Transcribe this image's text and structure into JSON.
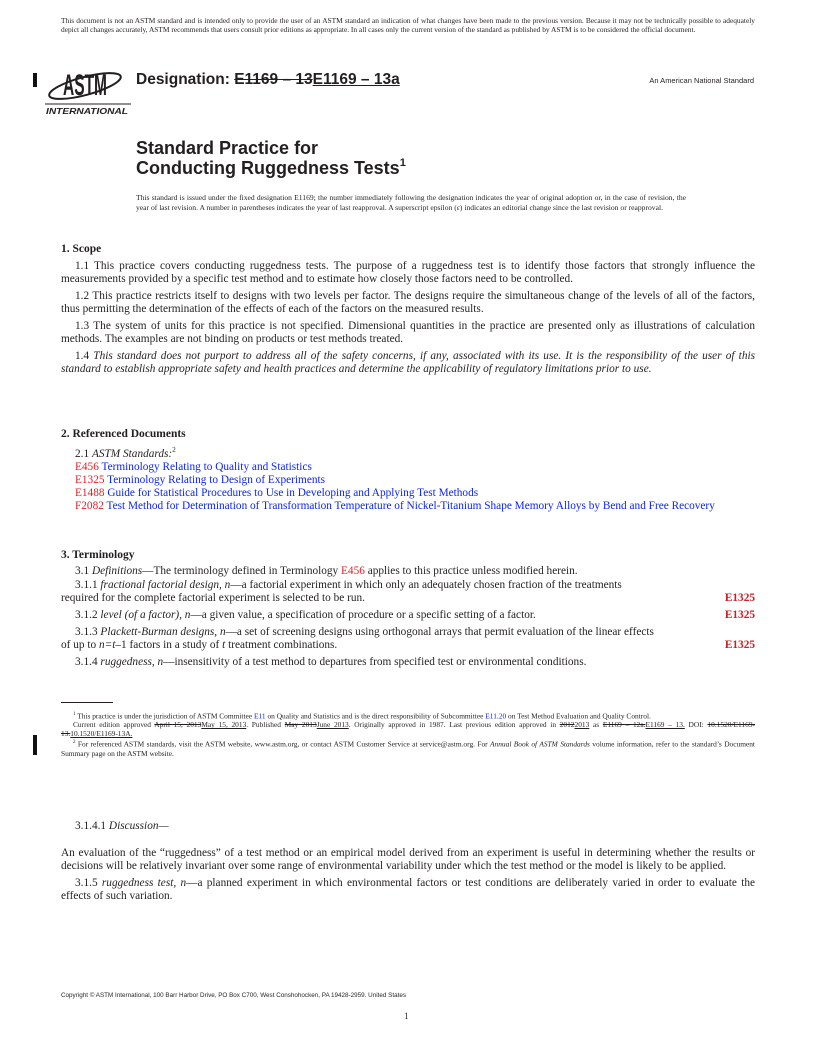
{
  "notice": "This document is not an ASTM standard and is intended only to provide the user of an ASTM standard an indication of what changes have been made to the previous version. Because it may not be technically possible to adequately depict all changes accurately, ASTM recommends that users consult prior editions as appropriate. In all cases only the current version of the standard as published by ASTM is to be considered the official document.",
  "header": {
    "logo_text": "ASTM",
    "logo_subtext": "INTERNATIONAL",
    "designation_label": "Designation:",
    "designation_old": "E1169 – 13",
    "designation_new": "E1169 – 13a",
    "national_standard": "An American National Standard"
  },
  "title": {
    "line1": "Standard Practice for",
    "line2": "Conducting Ruggedness Tests",
    "footnote_mark": "1"
  },
  "issued_note": "This standard is issued under the fixed designation E1169; the number immediately following the designation indicates the year of original adoption or, in the case of revision, the year of last revision. A number in parentheses indicates the year of last reapproval. A superscript epsilon (ε) indicates an editorial change since the last revision or reapproval.",
  "scope": {
    "heading": "1. Scope",
    "p1_1": "1.1 This practice covers conducting ruggedness tests. The purpose of a ruggedness test is to identify those factors that strongly influence the measurements provided by a specific test method and to estimate how closely those factors need to be controlled.",
    "p1_2": "1.2 This practice restricts itself to designs with two levels per factor. The designs require the simultaneous change of the levels of all of the factors, thus permitting the determination of the effects of each of the factors on the measured results.",
    "p1_3": "1.3 The system of units for this practice is not specified. Dimensional quantities in the practice are presented only as illustrations of calculation methods. The examples are not binding on products or test methods treated.",
    "p1_4_num": "1.4",
    "p1_4": "This standard does not purport to address all of the safety concerns, if any, associated with its use. It is the responsibility of the user of this standard to establish appropriate safety and health practices and determine the applicability of regulatory limitations prior to use."
  },
  "referenced": {
    "heading": "2. Referenced Documents",
    "intro_num": "2.1",
    "intro": "ASTM Standards:",
    "intro_mark": "2",
    "items": [
      {
        "code": "E456",
        "title": "Terminology Relating to Quality and Statistics"
      },
      {
        "code": "E1325",
        "title": "Terminology Relating to Design of Experiments"
      },
      {
        "code": "E1488",
        "title": "Guide for Statistical Procedures to Use in Developing and Applying Test Methods"
      },
      {
        "code": "F2082",
        "title": "Test Method for Determination of Transformation Temperature of Nickel-Titanium Shape Memory Alloys by Bend and Free Recovery"
      }
    ]
  },
  "terminology": {
    "heading": "3. Terminology",
    "t3_1_num": "3.1",
    "t3_1_term": "Definitions",
    "t3_1_a": "—The terminology defined in Terminology",
    "t3_1_ref": "E456",
    "t3_1_b": "applies to this practice unless modified herein.",
    "t3_1_1_num": "3.1.1",
    "t3_1_1_term": "fractional factorial design, n",
    "t3_1_1_a": "—a factorial experiment in which only an adequately chosen fraction of the treatments",
    "t3_1_1_b": "required for the complete factorial experiment is selected to be run.",
    "t3_1_1_src": "E1325",
    "t3_1_2_num": "3.1.2",
    "t3_1_2_term": "level (of a factor), n",
    "t3_1_2_a": "—a given value, a specification of procedure or a specific setting of a factor.",
    "t3_1_2_src": "E1325",
    "t3_1_3_num": "3.1.3",
    "t3_1_3_term": "Plackett-Burman designs, n",
    "t3_1_3_a": "—a set of screening designs using orthogonal arrays that permit evaluation of the linear effects",
    "t3_1_3_b1": "of up to",
    "t3_1_3_n": "n=t",
    "t3_1_3_b2": "–1 factors in a study of",
    "t3_1_3_t": "t",
    "t3_1_3_b3": "treatment combinations.",
    "t3_1_3_src": "E1325",
    "t3_1_4_num": "3.1.4",
    "t3_1_4_term": "ruggedness, n",
    "t3_1_4_a": "—insensitivity of a test method to departures from specified test or environmental conditions.",
    "t3_1_4_1_num": "3.1.4.1",
    "t3_1_4_1_term": "Discussion—",
    "discussion": "An evaluation of the “ruggedness” of a test method or an empirical model derived from an experiment is useful in determining whether the results or decisions will be relatively invariant over some range of environmental variability under which the test method or the model is likely to be applied.",
    "t3_1_5_num": "3.1.5",
    "t3_1_5_term": "ruggedness test, n",
    "t3_1_5_a": "—a planned experiment in which environmental factors or test conditions are deliberately varied in order to evaluate the effects of such variation."
  },
  "footnotes": {
    "fn1_mark": "1",
    "fn1_a": "This practice is under the jurisdiction of ASTM Committee",
    "fn1_ref1": "E11",
    "fn1_b": "on Quality and Statistics and is the direct responsibility of Subcommittee",
    "fn1_ref2": "E11.20",
    "fn1_c": "on Test Method Evaluation and Quality Control.",
    "edition_a": "Current edition approved",
    "edition_old_date": "April 15, 2013",
    "edition_new_date": "May 15, 2013",
    "edition_b": ". Published",
    "published_old": "May 2013",
    "published_new": "June 2013",
    "edition_c": ". Originally approved in 1987. Last previous edition approved in",
    "prev_old": "2012",
    "prev_new": "2013",
    "edition_d": "as",
    "as_old": "E1169 – 12a.",
    "as_new": "E1169 – 13.",
    "doi_label": "DOI:",
    "doi_old": "10.1520/E1169-13.",
    "doi_new": "10.1520/E1169-13A.",
    "fn2_mark": "2",
    "fn2_a": "For referenced ASTM standards, visit the ASTM website, www.astm.org, or contact ASTM Customer Service at service@astm.org. For",
    "fn2_italic": "Annual Book of ASTM Standards",
    "fn2_b": "volume information, refer to the standard’s Document Summary page on the ASTM website."
  },
  "footer": {
    "copyright": "Copyright © ASTM International, 100 Barr Harbor Drive, PO Box C700, West Conshohocken, PA 19428-2959. United States",
    "page_number": "1"
  }
}
